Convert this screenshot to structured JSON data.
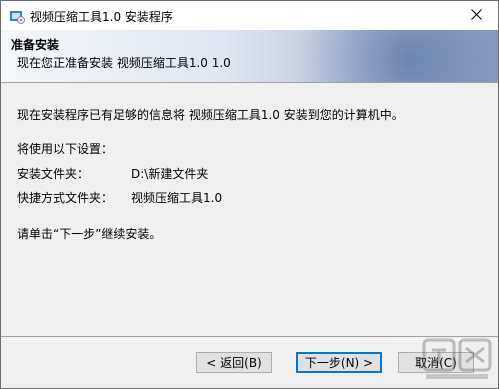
{
  "window": {
    "title": "视频压缩工具1.0 安装程序"
  },
  "header": {
    "title": "准备安装",
    "subtitle": "现在您正准备安装 视频压缩工具1.0 1.0"
  },
  "content": {
    "intro": "现在安装程序已有足够的信息将 视频压缩工具1.0 安装到您的计算机中。",
    "settings_heading": "将使用以下设置：",
    "install_folder_label": "安装文件夹：",
    "install_folder_value": "D:\\新建文件夹",
    "shortcut_folder_label": "快捷方式文件夹：",
    "shortcut_folder_value": "视频压缩工具1.0",
    "instruction": "请单击“下一步”继续安装。"
  },
  "buttons": {
    "back": "< 返回(B)",
    "next": "下一步(N) >",
    "cancel": "取消(C)"
  },
  "icons": {
    "app": "installer-icon",
    "close": "close-icon"
  }
}
